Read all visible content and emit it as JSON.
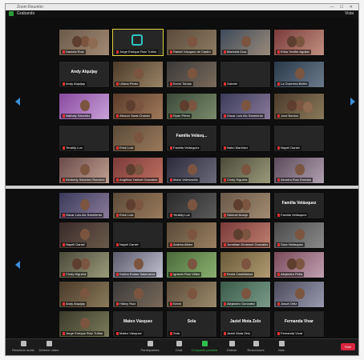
{
  "window": {
    "title": "Zoom Reunión",
    "controls": "— ☐ ✕"
  },
  "infobar": {
    "label": "Grabando",
    "view": "Vista"
  },
  "pane1": {
    "tiles": [
      {
        "name": "Daniela Ruiz",
        "kind": "video",
        "c1": "#6b5a4a",
        "c2": "#a28a74",
        "faces": 3
      },
      {
        "name": "Jorge Enrique Ruiz Tuñón",
        "kind": "logo",
        "active": true
      },
      {
        "name": "Rafael Vázquez de Castro",
        "kind": "video",
        "c1": "#5a4a3a",
        "c2": "#8d7b63",
        "faces": 1
      },
      {
        "name": "Maricela Díaz",
        "kind": "video",
        "c1": "#3e4a5a",
        "c2": "#9a8a7a",
        "faces": 1
      },
      {
        "name": "Erika Yenifer Aguilar",
        "kind": "video",
        "c1": "#7a3a3a",
        "c2": "#c09080",
        "faces": 2
      },
      {
        "name": "Andy Alquijay",
        "kind": "name",
        "big": "Andy Alquijay"
      },
      {
        "name": "Liliana Pérez",
        "kind": "video",
        "c1": "#4a3a2a",
        "c2": "#9b8466",
        "faces": 1
      },
      {
        "name": "Kevin Tobías",
        "kind": "video",
        "c1": "#3a3a3a",
        "c2": "#7a6a5a",
        "faces": 1
      },
      {
        "name": "Gabriel",
        "kind": "dark"
      },
      {
        "name": "La Guerrera Belén",
        "kind": "video",
        "c1": "#2a3a4a",
        "c2": "#6a7a8a",
        "faces": 1
      },
      {
        "name": "Nathaly Sánchez",
        "kind": "video",
        "c1": "#8a4aa0",
        "c2": "#c7a0d8",
        "faces": 1
      },
      {
        "name": "Alisson Sarai Chavez",
        "kind": "video",
        "c1": "#5a3a2a",
        "c2": "#a07a5a",
        "faces": 2
      },
      {
        "name": "Ryan Pérez",
        "kind": "video",
        "c1": "#3a4a3a",
        "c2": "#7a8a6a",
        "faces": 2
      },
      {
        "name": "Oscar Luis Alc Sarmiento",
        "kind": "video",
        "c1": "#3a3a5a",
        "c2": "#8a7a9a",
        "faces": 1
      },
      {
        "name": "José Barrios",
        "kind": "video",
        "c1": "#4a3a2a",
        "c2": "#8a7a5a",
        "faces": 3
      },
      {
        "name": "Yeraldy Luz",
        "kind": "dark"
      },
      {
        "name": "Erick Luis",
        "kind": "video",
        "c1": "#5a4a3a",
        "c2": "#9a7a5a",
        "faces": 1
      },
      {
        "name": "Familia Velásquez",
        "kind": "name",
        "big": "Familia Velásq..."
      },
      {
        "name": "Nahú Martínez",
        "kind": "dark"
      },
      {
        "name": "Nayeli Daniel",
        "kind": "dark"
      },
      {
        "name": "Kimberly Sánchez Ramírez",
        "kind": "video",
        "c1": "#6a4a4a",
        "c2": "#c0a090",
        "faces": 1
      },
      {
        "name": "Angélica Yaritzel Gonzalez",
        "kind": "video",
        "c1": "#7a3a3a",
        "c2": "#c07060",
        "faces": 2
      },
      {
        "name": "Mario Valenzuela",
        "kind": "video",
        "c1": "#2a2a3a",
        "c2": "#6a6a7a",
        "faces": 1
      },
      {
        "name": "Cindy Higuera",
        "kind": "video",
        "c1": "#4a4a3a",
        "c2": "#9a9a7a",
        "faces": 1
      },
      {
        "name": "Alondra Ruiz Ernesto",
        "kind": "video",
        "c1": "#5a4a5a",
        "c2": "#b0a0b0",
        "faces": 1
      }
    ]
  },
  "pane2": {
    "tiles": [
      {
        "name": "Oscar Luis Alc Sarmiento",
        "kind": "video",
        "c1": "#3a3a5a",
        "c2": "#8a7a9a",
        "faces": 1
      },
      {
        "name": "Erick Luis",
        "kind": "video",
        "c1": "#5a4a3a",
        "c2": "#9a7a5a",
        "faces": 2
      },
      {
        "name": "Yeraldy Luz",
        "kind": "video",
        "c1": "#2a2a2a",
        "c2": "#5a5a5a",
        "faces": 1
      },
      {
        "name": "Samuel Araujo",
        "kind": "video",
        "c1": "#6a5a4a",
        "c2": "#a08a70",
        "faces": 2
      },
      {
        "name": "Familia Velásquez",
        "kind": "name",
        "big": "Familia Velásquez"
      },
      {
        "name": "Nayeli Daniel",
        "kind": "video",
        "c1": "#3a2a2a",
        "c2": "#6a5a4a",
        "faces": 1
      },
      {
        "name": "Nayeli Daniel",
        "kind": "dark"
      },
      {
        "name": "Andrea Alfaro",
        "kind": "video",
        "c1": "#5a4a3a",
        "c2": "#9a8060",
        "faces": 1
      },
      {
        "name": "Jonathan Emanuel Gonzalez",
        "kind": "video",
        "c1": "#7a3a3a",
        "c2": "#c08070",
        "faces": 2
      },
      {
        "name": "Sara Velásquez",
        "kind": "video",
        "c1": "#4a4a4a",
        "c2": "#8a8a8a",
        "faces": 1
      },
      {
        "name": "Cindy Higuera",
        "kind": "video",
        "c1": "#4a4a3a",
        "c2": "#9a9a7a",
        "faces": 2
      },
      {
        "name": "Karina Rodas Salanueva",
        "kind": "video",
        "c1": "#5a5a6a",
        "c2": "#c0c0d0",
        "faces": 1
      },
      {
        "name": "Ignacio Ruiz Vélez",
        "kind": "video",
        "c1": "#4a6a3a",
        "c2": "#8ab070",
        "faces": 1
      },
      {
        "name": "Kenia Castellanos",
        "kind": "video",
        "c1": "#6a5a3a",
        "c2": "#b09a70",
        "faces": 1
      },
      {
        "name": "Alejandra Peña",
        "kind": "video",
        "c1": "#7a4a5a",
        "c2": "#c0a0b0",
        "faces": 2
      },
      {
        "name": "Andy Alquijay",
        "kind": "video",
        "c1": "#4a3a2a",
        "c2": "#8a7a5a",
        "faces": 1
      },
      {
        "name": "Hillary Ruiz",
        "kind": "video",
        "c1": "#3a3a3a",
        "c2": "#7a6a5a",
        "faces": 1
      },
      {
        "name": "Kevin",
        "kind": "video",
        "c1": "#5a4a3a",
        "c2": "#9a8a6a",
        "faces": 1
      },
      {
        "name": "Alejandro Gonzalez",
        "kind": "video",
        "c1": "#3a5a4a",
        "c2": "#7a9a8a",
        "faces": 1
      },
      {
        "name": "Josué Ortiz",
        "kind": "video",
        "c1": "#4a4a5a",
        "c2": "#9a9ab0",
        "faces": 1
      },
      {
        "name": "Jorge Enrique Ruiz Tuñón",
        "kind": "video",
        "c1": "#3a3a2a",
        "c2": "#7a7a5a",
        "faces": 1
      },
      {
        "name": "Mateo Vásquez",
        "kind": "name",
        "big": "Mateo Vásquez"
      },
      {
        "name": "Sola",
        "kind": "name",
        "big": "Sola"
      },
      {
        "name": "Jaziel Mota Zelo",
        "kind": "name",
        "big": "Jaziel Mota Zelo"
      },
      {
        "name": "Fernanda Vivar",
        "kind": "name",
        "big": "Fernanda Vivar"
      }
    ]
  },
  "toolbar": {
    "mute": "Reactivar audio",
    "video": "Detener video",
    "participants": "Participantes",
    "chat": "Chat",
    "share": "Compartir pantalla",
    "record": "Grabar",
    "reactions": "Reacciones",
    "more": "Más",
    "end": "Salir"
  },
  "colors": {
    "accent": "#2fbf4f",
    "end": "#d8263e",
    "arrow": "#3b8fd9",
    "active_border": "#e0d23a"
  }
}
